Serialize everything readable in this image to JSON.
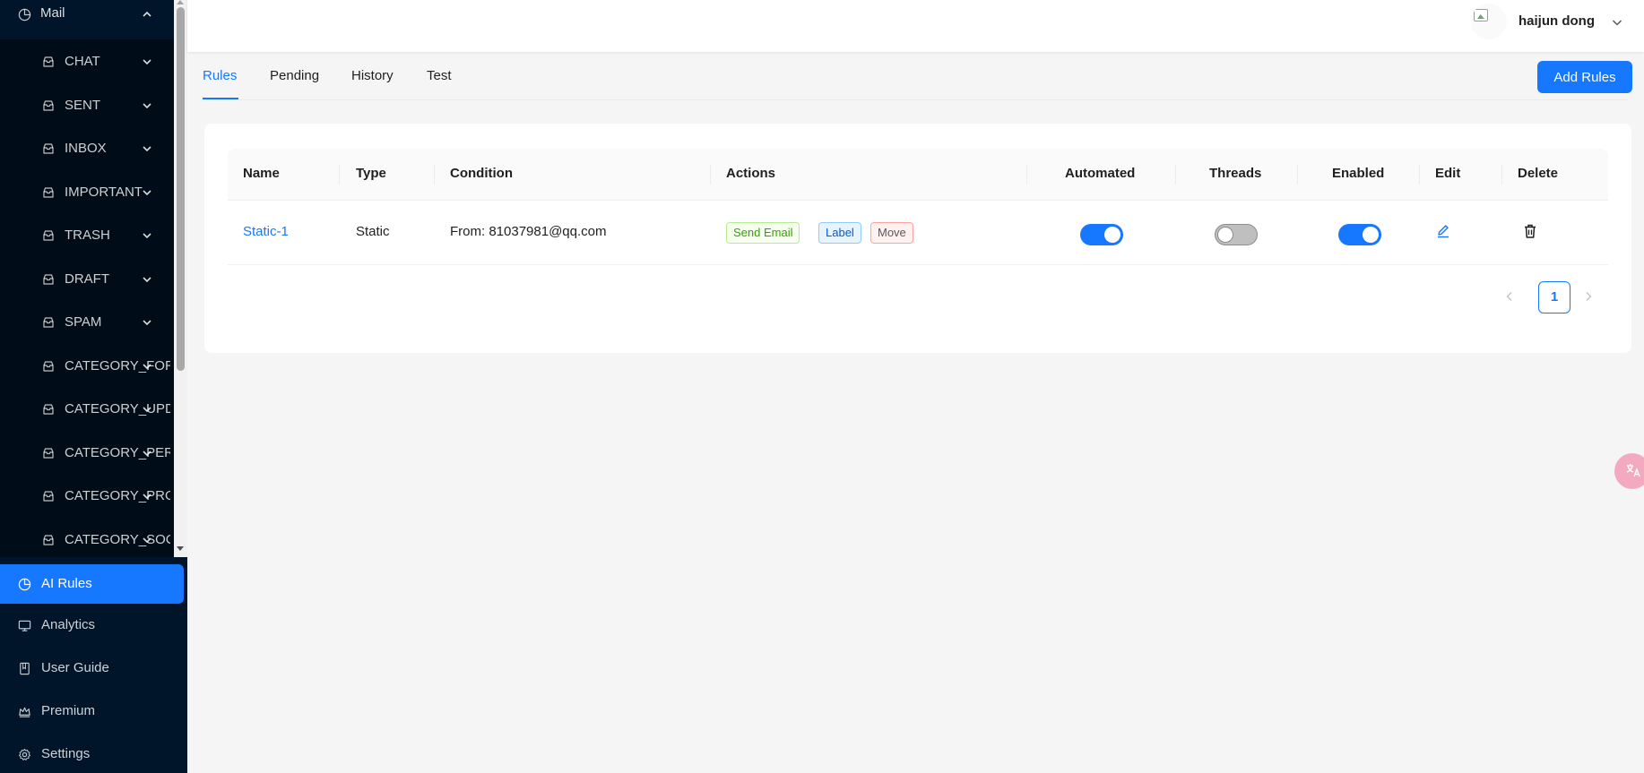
{
  "sidebar": {
    "mail_label": "Mail",
    "mail_items": [
      {
        "label": "CHAT"
      },
      {
        "label": "SENT"
      },
      {
        "label": "INBOX"
      },
      {
        "label": "IMPORTANT"
      },
      {
        "label": "TRASH"
      },
      {
        "label": "DRAFT"
      },
      {
        "label": "SPAM"
      },
      {
        "label": "CATEGORY_FORUMS"
      },
      {
        "label": "CATEGORY_UPDATES"
      },
      {
        "label": "CATEGORY_PERSONAL"
      },
      {
        "label": "CATEGORY_PROMOTIONS"
      },
      {
        "label": "CATEGORY_SOCIAL"
      }
    ],
    "nav": [
      {
        "label": "AI Rules",
        "icon": "pie-chart-icon",
        "active": true
      },
      {
        "label": "Analytics",
        "icon": "desktop-icon"
      },
      {
        "label": "User Guide",
        "icon": "book-icon"
      },
      {
        "label": "Premium",
        "icon": "crown-icon"
      },
      {
        "label": "Settings",
        "icon": "gear-icon"
      }
    ]
  },
  "header": {
    "user_name": "haijun dong"
  },
  "tabs": [
    {
      "label": "Rules",
      "active": true
    },
    {
      "label": "Pending"
    },
    {
      "label": "History"
    },
    {
      "label": "Test"
    }
  ],
  "add_button": "Add Rules",
  "table": {
    "columns": [
      "Name",
      "Type",
      "Condition",
      "Actions",
      "Automated",
      "Threads",
      "Enabled",
      "Edit",
      "Delete"
    ],
    "rows": [
      {
        "name": "Static-1",
        "type": "Static",
        "condition": "From: 81037981@qq.com",
        "actions": [
          "Send Email",
          "Label",
          "Move"
        ],
        "automated": true,
        "threads": false,
        "enabled": true
      }
    ]
  },
  "pagination": {
    "current": "1"
  },
  "colors": {
    "sidebar_bg": "#001529",
    "submenu_bg": "#000c17",
    "accent": "#1677ff"
  }
}
